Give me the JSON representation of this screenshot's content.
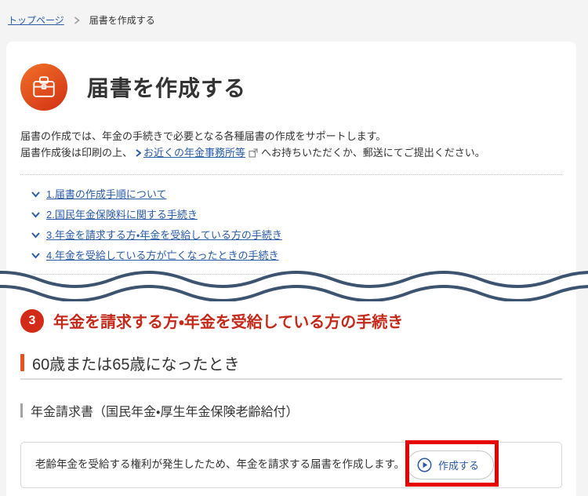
{
  "breadcrumb": {
    "home_label": "トップページ",
    "current_label": "届書を作成する"
  },
  "header": {
    "title": "届書を作成する",
    "icon": "briefcase-icon"
  },
  "intro": {
    "line1": "届書の作成では、年金の手続きで必要となる各種届書の作成をサポートします。",
    "line2_prefix": "届書作成後は印刷の上、",
    "link_label": "お近くの年金事務所等",
    "link_icon": "external-link-icon",
    "line2_suffix": "へお持ちいただくか、郵送にてご提出ください。"
  },
  "toc": {
    "items": [
      {
        "label": "1.届書の作成手順について"
      },
      {
        "label": "2.国民年金保険料に関する手続き"
      },
      {
        "label": "3.年金を請求する方・年金を受給している方の手続き"
      },
      {
        "label": "4.年金を受給している方が亡くなったときの手続き"
      }
    ]
  },
  "section3": {
    "number": "3",
    "title": "年金を請求する方・年金を受給している方の手続き"
  },
  "subsection": {
    "title": "60歳または65歳になったとき"
  },
  "group": {
    "title": "年金請求書（国民年金・厚生年金保険老齢給付）"
  },
  "item": {
    "description": "老齢年金を受給する権利が発生したため、年金を請求する届書を作成します。",
    "button_label": "作成する",
    "button_icon": "play-circle-icon"
  },
  "colors": {
    "page_background": "#f4f4f5",
    "card_background": "#ffffff",
    "link_blue": "#2a5ca8",
    "button_blue": "#2c5aa5",
    "header_icon_orange": "#e2511f",
    "badge_red": "#d22c18",
    "section_title_red": "#c5291a",
    "accent_bar_orange": "#e8501c",
    "wave_navy": "#3d5471",
    "annotation_red": "#e60000"
  }
}
